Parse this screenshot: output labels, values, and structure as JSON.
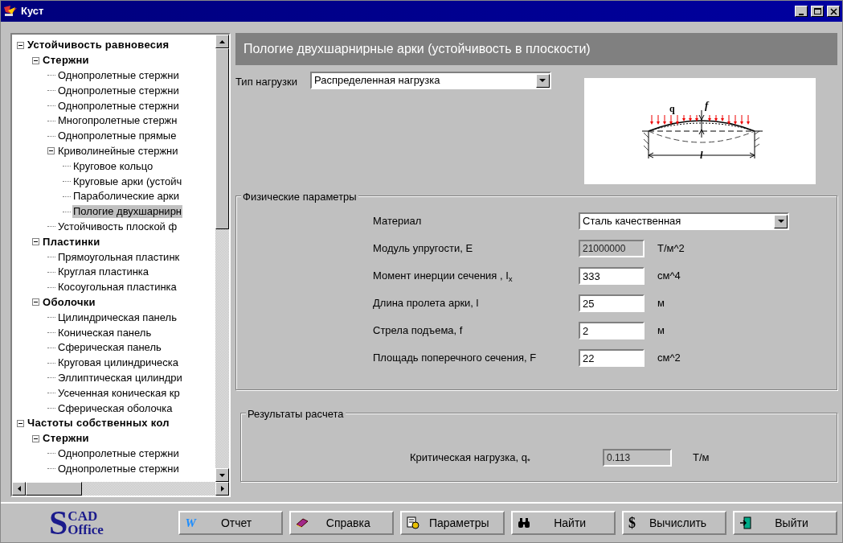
{
  "window": {
    "title": "Куст"
  },
  "tree": [
    {
      "label": "Устойчивость равновесия",
      "expanded": true,
      "selected": false,
      "children": [
        {
          "label": "Стержни",
          "expanded": true,
          "selected": false,
          "children": [
            {
              "label": "Однопролетные стержни",
              "selected": false
            },
            {
              "label": "Однопролетные стержни",
              "selected": false
            },
            {
              "label": "Однопролетные стержни",
              "selected": false
            },
            {
              "label": "Многопролетные стержн",
              "selected": false
            },
            {
              "label": "Однопролетные прямые",
              "selected": false
            },
            {
              "label": "Криволинейные стержни",
              "expanded": true,
              "selected": false,
              "children": [
                {
                  "label": "Круговое кольцо",
                  "selected": false
                },
                {
                  "label": "Круговые арки (устойч",
                  "selected": false
                },
                {
                  "label": "Параболические арки",
                  "selected": false
                },
                {
                  "label": "Пологие двухшарнирн",
                  "selected": true
                }
              ]
            },
            {
              "label": "Устойчивость плоской ф",
              "selected": false
            }
          ]
        },
        {
          "label": "Пластинки",
          "expanded": true,
          "selected": false,
          "children": [
            {
              "label": "Прямоугольная пластинк",
              "selected": false
            },
            {
              "label": "Круглая пластинка",
              "selected": false
            },
            {
              "label": "Косоугольная пластинка",
              "selected": false
            }
          ]
        },
        {
          "label": "Оболочки",
          "expanded": true,
          "selected": false,
          "children": [
            {
              "label": "Цилиндрическая панель",
              "selected": false
            },
            {
              "label": "Коническая панель",
              "selected": false
            },
            {
              "label": "Сферическая панель",
              "selected": false
            },
            {
              "label": "Круговая цилиндрическа",
              "selected": false
            },
            {
              "label": "Эллиптическая цилиндри",
              "selected": false
            },
            {
              "label": "Усеченная коническая кр",
              "selected": false
            },
            {
              "label": "Сферическая оболочка",
              "selected": false
            }
          ]
        }
      ]
    },
    {
      "label": "Частоты собственных кол",
      "expanded": true,
      "selected": false,
      "children": [
        {
          "label": "Стержни",
          "expanded": true,
          "selected": false,
          "children": [
            {
              "label": "Однопролетные стержни",
              "selected": false
            },
            {
              "label": "Однопролетные стержни",
              "selected": false
            }
          ]
        }
      ]
    }
  ],
  "panel_title": "Пологие двухшарнирные арки (устойчивость в плоскости)",
  "load_type": {
    "label": "Тип нагрузки",
    "value": "Распределенная нагрузка"
  },
  "diagram": {
    "load_label": "q",
    "rise_label": "f",
    "span_label": "l"
  },
  "physical": {
    "title": "Физические параметры",
    "rows": [
      {
        "kind": "select",
        "label": "Материал",
        "value": "Сталь качественная"
      },
      {
        "kind": "readonly",
        "label": "Модуль упругости, E",
        "value": "21000000",
        "unit": "Т/м^2"
      },
      {
        "kind": "input",
        "label": "Момент инерции сечения , I$_{x}$",
        "value": "333",
        "unit": "см^4"
      },
      {
        "kind": "input",
        "label": "Длина пролета арки, l",
        "value": "25",
        "unit": "м"
      },
      {
        "kind": "input",
        "label": "Стрела подъема, f",
        "value": "2",
        "unit": "м"
      },
      {
        "kind": "input",
        "label": "Площадь поперечного сечения, F",
        "value": "22",
        "unit": "см^2"
      }
    ]
  },
  "results": {
    "title": "Результаты расчета",
    "label": "Критическая нагрузка, q$_{*}$",
    "value": "0.113",
    "unit": "Т/м"
  },
  "logo": {
    "big": "S",
    "top": "CAD",
    "bottom": "Office"
  },
  "buttons": [
    {
      "kind": "report",
      "glyph": "W",
      "label": "Отчет"
    },
    {
      "kind": "help",
      "label": "Справка"
    },
    {
      "kind": "params",
      "label": "Параметры"
    },
    {
      "kind": "find",
      "label": "Найти"
    },
    {
      "kind": "calc",
      "glyph": "$",
      "label": "Вычислить"
    },
    {
      "kind": "exit",
      "label": "Выйти"
    }
  ]
}
